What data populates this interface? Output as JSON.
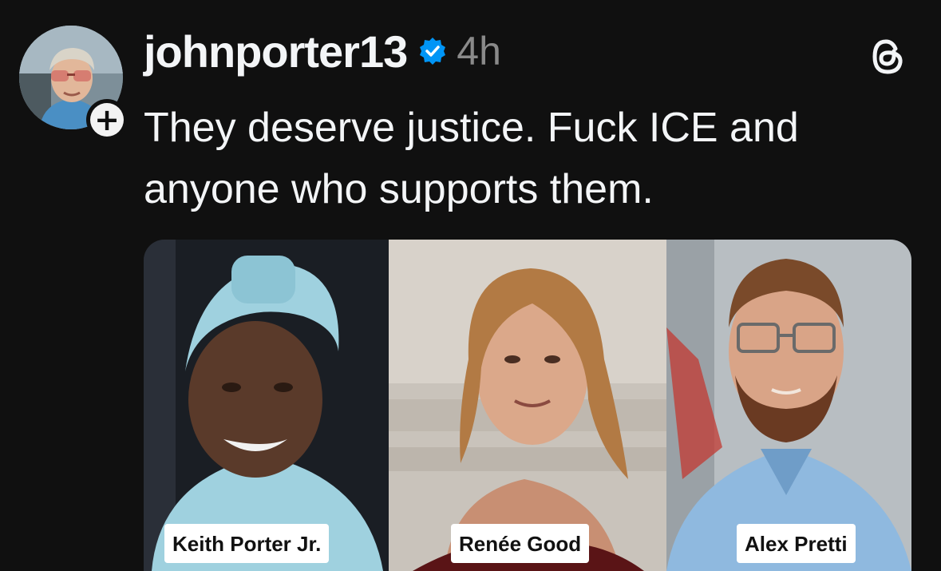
{
  "post": {
    "username": "johnporter13",
    "timestamp": "4h",
    "caption": "They deserve justice. Fuck ICE and anyone who supports them.",
    "verified": true,
    "follow_symbol": "+"
  },
  "icons": {
    "verified": "verified-badge-icon",
    "threads": "threads-logo-icon",
    "follow": "plus-icon"
  },
  "media": {
    "panels": [
      {
        "label": "Keith Porter Jr."
      },
      {
        "label": "Renée Good"
      },
      {
        "label": "Alex Pretti"
      }
    ]
  },
  "colors": {
    "background": "#101010",
    "text": "#f3f5f7",
    "muted": "#8a8a8a",
    "verified": "#0095f6"
  }
}
